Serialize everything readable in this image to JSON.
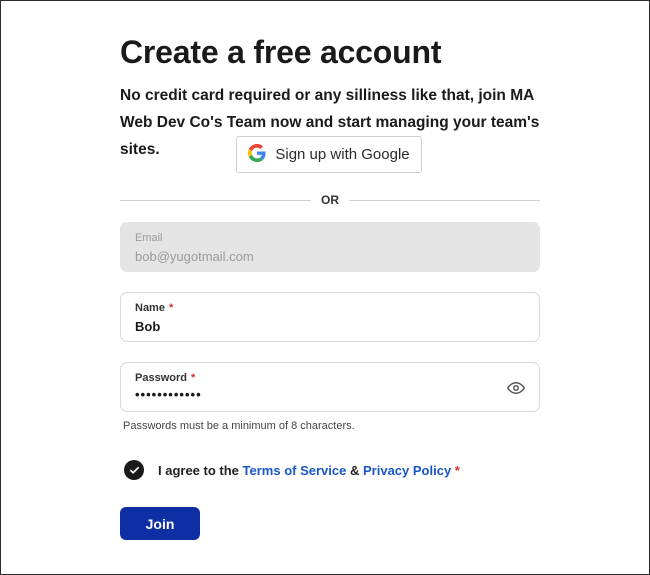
{
  "heading": "Create a free account",
  "subtitle": "No credit card required or any silliness like that, join MA Web Dev Co's Team now and start managing your team's sites.",
  "google_button": {
    "label": "Sign up with Google",
    "icon": "google-icon"
  },
  "divider_text": "OR",
  "email": {
    "label": "Email",
    "value": "bob@yugotmail.com",
    "disabled": true
  },
  "name": {
    "label": "Name",
    "required_mark": "*",
    "value": "Bob"
  },
  "password": {
    "label": "Password",
    "required_mark": "*",
    "value": "••••••••••••",
    "toggle_icon": "eye-icon"
  },
  "password_hint": "Passwords must be a minimum of 8 characters.",
  "agreement": {
    "checked": true,
    "prefix": "I agree to the",
    "terms_link": "Terms of Service",
    "joiner": "&",
    "privacy_link": "Privacy Policy",
    "required_mark": "*"
  },
  "join_button": "Join",
  "colors": {
    "primary_button": "#0d2fa3",
    "link": "#1a56c8",
    "required": "#d32f2f",
    "disabled_field": "#e4e4e4"
  }
}
